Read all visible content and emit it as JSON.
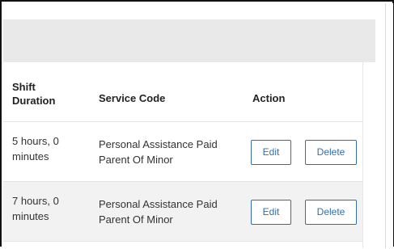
{
  "table": {
    "headers": {
      "shift_duration": "Shift Duration",
      "service_code": "Service Code",
      "action": "Action"
    },
    "rows": [
      {
        "shift_duration": "5 hours, 0 minutes",
        "service_code": "Personal Assistance Paid Parent Of Minor",
        "edit_label": "Edit",
        "delete_label": "Delete"
      },
      {
        "shift_duration": "7 hours, 0 minutes",
        "service_code": "Personal Assistance Paid Parent Of Minor",
        "edit_label": "Edit",
        "delete_label": "Delete"
      }
    ]
  },
  "colors": {
    "button_accent": "#2f6fae",
    "band_gray": "#e9e9e9",
    "alt_row": "#f2f2f2"
  }
}
